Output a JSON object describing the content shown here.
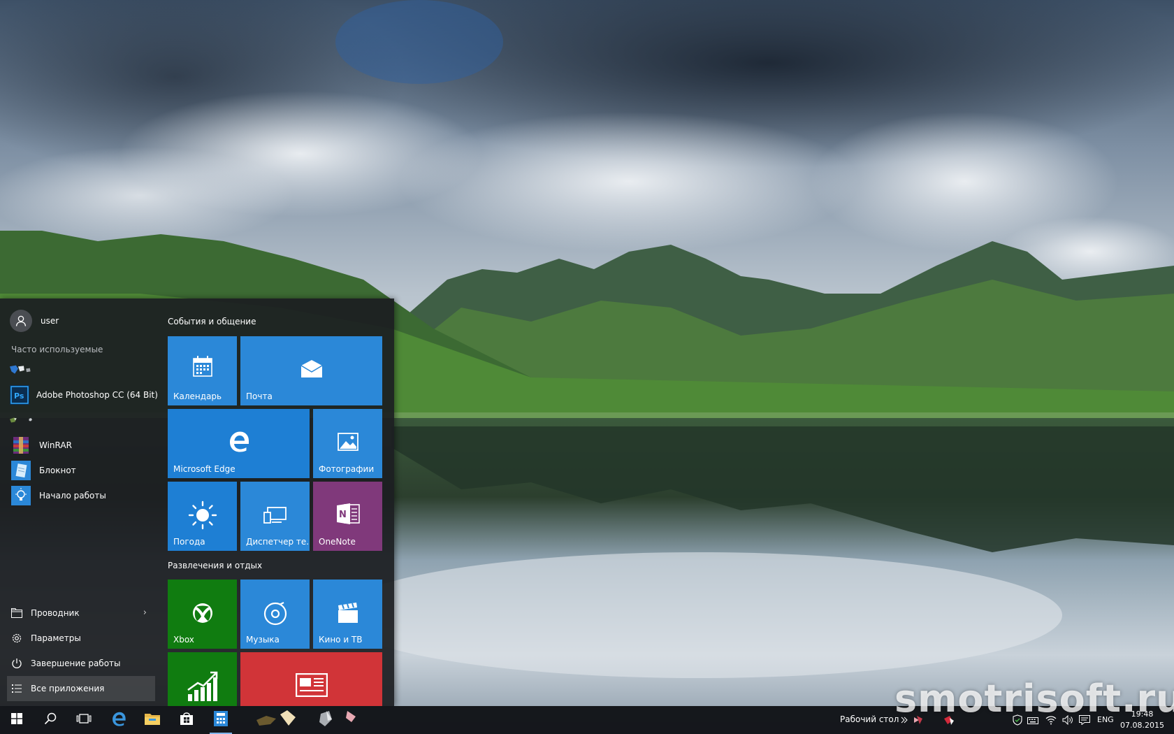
{
  "start_menu": {
    "user_name": "user",
    "most_used_heading": "Часто используемые",
    "apps": [
      {
        "label": "",
        "icon": "blank-app-icon"
      },
      {
        "label": "Adobe Photoshop CC (64 Bit)",
        "icon": "photoshop-icon"
      },
      {
        "label": "",
        "icon": "blank-app-icon"
      },
      {
        "label": "WinRAR",
        "icon": "winrar-icon"
      },
      {
        "label": "Блокнот",
        "icon": "notepad-icon"
      },
      {
        "label": "Начало работы",
        "icon": "lightbulb-icon"
      }
    ],
    "bottom": {
      "explorer": "Проводник",
      "settings": "Параметры",
      "power": "Завершение работы",
      "all_apps": "Все приложения"
    },
    "groups": [
      {
        "title": "События и общение",
        "tiles": [
          {
            "label": "Календарь",
            "icon": "calendar-icon",
            "color": "#2b88d8"
          },
          {
            "label": "Почта",
            "icon": "mail-icon",
            "color": "#2b88d8"
          },
          {
            "label": "Microsoft Edge",
            "icon": "edge-icon",
            "color": "#1e7fd4"
          },
          {
            "label": "Фотографии",
            "icon": "photos-icon",
            "color": "#2b88d8"
          },
          {
            "label": "Погода",
            "icon": "weather-icon",
            "color": "#1e7fd4"
          },
          {
            "label": "Диспетчер те...",
            "icon": "phone-companion-icon",
            "color": "#2b88d8"
          },
          {
            "label": "OneNote",
            "icon": "onenote-icon",
            "color": "#80397b"
          }
        ]
      },
      {
        "title": "Развлечения и отдых",
        "tiles": [
          {
            "label": "Xbox",
            "icon": "xbox-icon",
            "color": "#107c10"
          },
          {
            "label": "Музыка",
            "icon": "music-icon",
            "color": "#2b88d8"
          },
          {
            "label": "Кино и ТВ",
            "icon": "film-icon",
            "color": "#2b88d8"
          },
          {
            "label": "",
            "icon": "finance-icon",
            "color": "#107c10"
          },
          {
            "label": "",
            "icon": "news-icon",
            "color": "#d13438"
          }
        ]
      }
    ]
  },
  "taskbar": {
    "pinned": [
      "start-icon",
      "search-icon",
      "task-view-icon",
      "edge-icon",
      "file-explorer-icon",
      "store-icon",
      "calculator-icon"
    ],
    "desktop_label": "Рабочий стол",
    "language": "ENG",
    "time": "19:48",
    "date": "07.08.2015"
  },
  "watermark": "smotrisoft.ru",
  "colors": {
    "accent": "#2b88d8",
    "taskbar": "#101216",
    "start_bg": "#1c1e21"
  }
}
